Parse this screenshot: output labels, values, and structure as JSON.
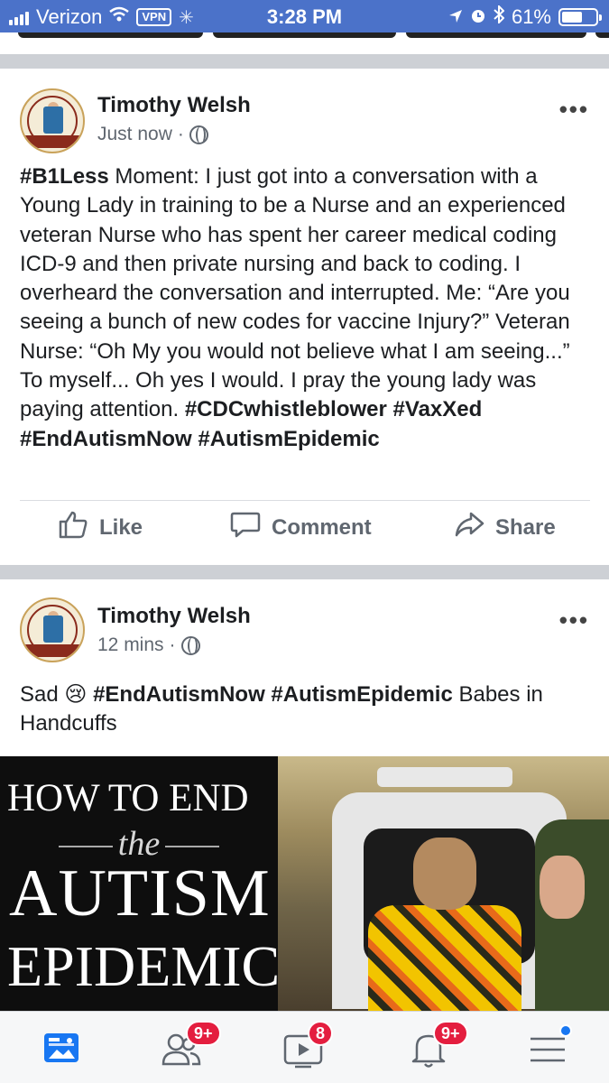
{
  "status_bar": {
    "carrier": "Verizon",
    "vpn": "VPN",
    "time": "3:28 PM",
    "battery": "61%",
    "battery_level": 0.61
  },
  "posts": [
    {
      "author": "Timothy Welsh",
      "time": "Just now",
      "dot": "·",
      "more": "•••",
      "segments": [
        {
          "text": "#B1Less",
          "bold": true
        },
        {
          "text": " Moment: I just got into a conversation with a Young Lady in training to be a Nurse and an experienced veteran Nurse who has spent her career medical coding ICD-9 and then private nursing and back to coding. I overheard the conversation and interrupted. Me: “Are you seeing a bunch of new codes for vaccine Injury?” Veteran Nurse: “Oh My you would not believe what I am seeing...” To myself... Oh yes I would. I pray the young lady was paying attention. ",
          "bold": false
        },
        {
          "text": "#CDCwhistleblower",
          "bold": true
        },
        {
          "text": " ",
          "bold": false
        },
        {
          "text": "#VaxXed",
          "bold": true
        },
        {
          "text": " ",
          "bold": false
        },
        {
          "text": "#EndAutismNow",
          "bold": true
        },
        {
          "text": " ",
          "bold": false
        },
        {
          "text": "#AutismEpidemic",
          "bold": true
        }
      ],
      "actions": {
        "like": "Like",
        "comment": "Comment",
        "share": "Share"
      }
    },
    {
      "author": "Timothy Welsh",
      "time": "12 mins",
      "dot": "·",
      "more": "•••",
      "segments": [
        {
          "text": "Sad 😢 ",
          "bold": false
        },
        {
          "text": "#EndAutismNow",
          "bold": true
        },
        {
          "text": " ",
          "bold": false
        },
        {
          "text": "#AutismEpidemic",
          "bold": true
        },
        {
          "text": " Babes in Handcuffs",
          "bold": false
        }
      ],
      "image": {
        "line1": "HOW TO END",
        "line2": "the",
        "line3": "AUTISM",
        "line4": "EPIDEMIC"
      }
    }
  ],
  "tab_bar": {
    "items": [
      {
        "icon": "news-feed-icon",
        "badge": ""
      },
      {
        "icon": "friends-icon",
        "badge": "9+"
      },
      {
        "icon": "video-icon",
        "badge": "8"
      },
      {
        "icon": "notifications-icon",
        "badge": "9+"
      },
      {
        "icon": "menu-icon",
        "badge": ""
      }
    ]
  },
  "colors": {
    "status_bar": "#4b72c9",
    "badge": "#e41e3f",
    "accent": "#1877f2",
    "secondary_text": "#606770"
  }
}
